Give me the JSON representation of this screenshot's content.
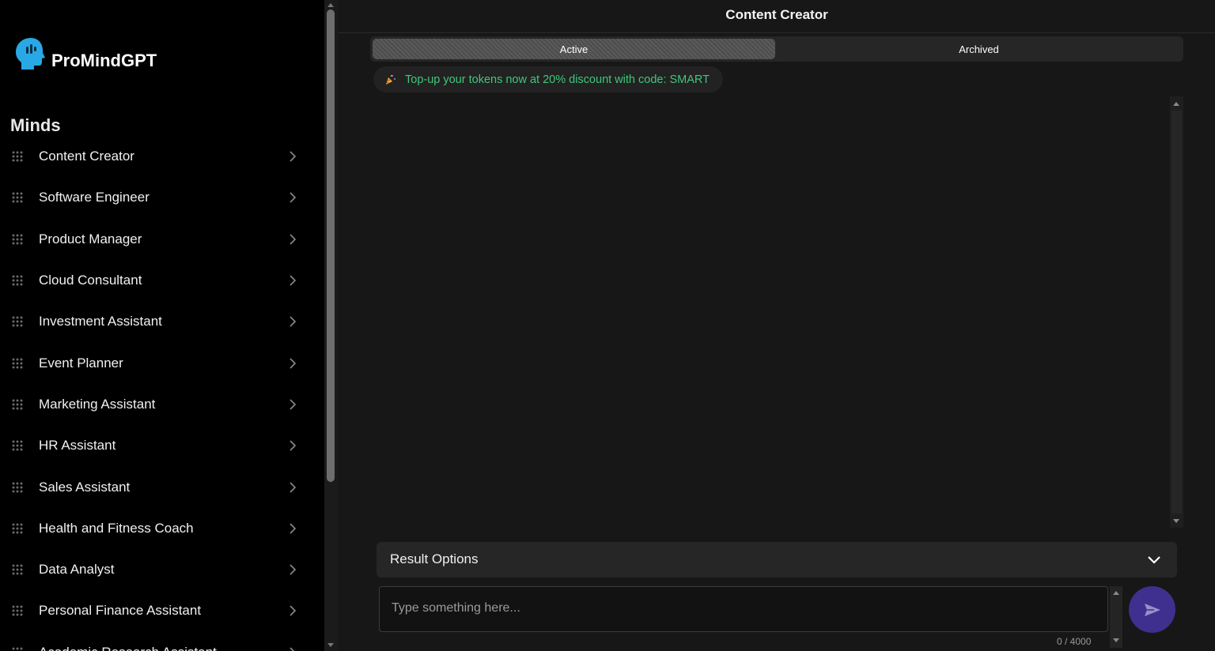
{
  "brand": {
    "name": "ProMindGPT"
  },
  "sidebar": {
    "title": "Minds",
    "items": [
      {
        "label": "Content Creator"
      },
      {
        "label": "Software Engineer"
      },
      {
        "label": "Product Manager"
      },
      {
        "label": "Cloud Consultant"
      },
      {
        "label": "Investment Assistant"
      },
      {
        "label": "Event Planner"
      },
      {
        "label": "Marketing Assistant"
      },
      {
        "label": "HR Assistant"
      },
      {
        "label": "Sales Assistant"
      },
      {
        "label": "Health and Fitness Coach"
      },
      {
        "label": "Data Analyst"
      },
      {
        "label": "Personal Finance Assistant"
      },
      {
        "label": "Academic Research Assistant"
      }
    ]
  },
  "header": {
    "title": "Content Creator"
  },
  "tabs": [
    {
      "label": "Active",
      "selected": true
    },
    {
      "label": "Archived",
      "selected": false
    }
  ],
  "promo": {
    "text": "Top-up your tokens now at 20% discount with code: SMART"
  },
  "result_options": {
    "label": "Result Options"
  },
  "input": {
    "placeholder": "Type something here...",
    "value": "",
    "counter": "0 / 4000"
  },
  "colors": {
    "accent": "#3f2f8f",
    "promo_text": "#3fc77a",
    "logo_blue": "#29a8e6"
  },
  "icons": {
    "logo": "head-silhouette-icon",
    "grip": "drag-grip-icon",
    "chevron": "chevron-right-icon",
    "promo": "party-popper-icon",
    "expand": "chevron-down-icon",
    "send": "send-icon"
  }
}
